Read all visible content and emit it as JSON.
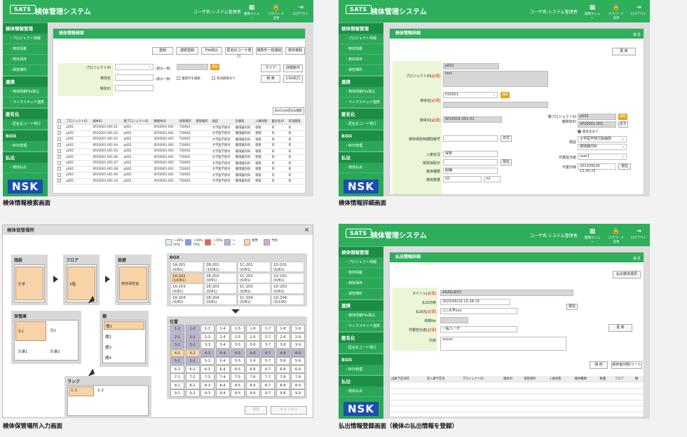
{
  "common": {
    "logo": "SATS",
    "app_title": "検体管理システム",
    "user": "ユーザ名:システム管理者",
    "menu1": "業務メニュー",
    "menu2": "パスワード変更",
    "menu3": "ログアウト",
    "nsk": "NSK",
    "nav": [
      {
        "t": "sec",
        "label": "検体情報管理"
      },
      {
        "t": "sub",
        "label": "・プロジェクト情報"
      },
      {
        "t": "sub",
        "label": "・検体情報"
      },
      {
        "t": "sub",
        "label": "・検体保存"
      },
      {
        "t": "sub",
        "label": "・保管場所"
      },
      {
        "t": "sec",
        "label": "連携"
      },
      {
        "t": "sub",
        "label": "・検体情報File取込"
      },
      {
        "t": "sub",
        "label": "・ラックスキャナ連携"
      },
      {
        "t": "sec",
        "label": "匿名化"
      },
      {
        "t": "sub",
        "label": "・匿名化コード発行"
      },
      {
        "t": "sec",
        "label": "BOX"
      },
      {
        "t": "sub",
        "label": "・BOX管理"
      },
      {
        "t": "sec",
        "label": "払出"
      },
      {
        "t": "sub",
        "label": "・検体払出"
      }
    ]
  },
  "captions": {
    "p1": "検体情報検索画面",
    "p2": "検体情報詳細画面",
    "p3": "検体保管場所入力画面",
    "p4": "払出情報登録画面（検体の払出情報を登録）"
  },
  "search": {
    "title": "検体情報検索",
    "buttons": [
      "登録",
      "連続登録",
      "File取込",
      "匿名化コード発行",
      "複数件一括連結",
      "検体複製"
    ],
    "label_project": "プロジェクトID",
    "label_name": "検体名",
    "label_sampleid": "検体ID",
    "chk_partial": "(部分一致)",
    "chk1": "連続行を検索",
    "chk2": "有効期限あり",
    "btn_go": "選択",
    "btn_clear": "クリア",
    "btn_detail": "詳細条件",
    "btn_search": "検 索",
    "btn_csv": "CSV出力",
    "btn_barcode": "BarCode読込&検索",
    "columns": [
      "",
      "プロジェクトID",
      "検体ID",
      "親プロジェクトID",
      "親検体ID",
      "保管場所",
      "保管場所",
      "組成",
      "診療科",
      "入庫状態",
      "匿名化ID",
      "有効期限"
    ],
    "rows": [
      [
        "",
        "p002",
        "SP20001-001-01",
        "p002",
        "SP20001-001",
        "T20001",
        "",
        "大学医学部付",
        "循環器内科",
        "保管",
        "有",
        "有"
      ],
      [
        "",
        "p002",
        "SP20001-001-02",
        "p002",
        "SP20001-001",
        "T20001",
        "",
        "大学医学部付",
        "循環器内科",
        "保管",
        "有",
        "有"
      ],
      [
        "",
        "p002",
        "SP20001-001-03",
        "p002",
        "SP20001-001",
        "T20001",
        "",
        "大学医学部付",
        "循環器内科",
        "保管",
        "有",
        "有"
      ],
      [
        "",
        "p002",
        "SP20001-001-04",
        "p002",
        "SP20001-001",
        "T20001",
        "",
        "大学医学部付",
        "循環器内科",
        "保管",
        "有",
        "有"
      ],
      [
        "",
        "p002",
        "SP20001-001-05",
        "p002",
        "SP20001-001",
        "T20001",
        "",
        "大学医学部付",
        "循環器内科",
        "保管",
        "有",
        "有"
      ],
      [
        "",
        "p002",
        "SP20001-001-06",
        "p002",
        "SP20001-001",
        "T20001",
        "",
        "大学医学部付",
        "循環器内科",
        "保管",
        "有",
        "有"
      ],
      [
        "",
        "p002",
        "SP20001-001-07",
        "p002",
        "SP20001-001",
        "T20001",
        "",
        "大学医学部付",
        "循環器内科",
        "保管",
        "有",
        "有"
      ],
      [
        "",
        "p002",
        "SP20001-001-08",
        "p002",
        "SP20001-001",
        "T20001",
        "",
        "大学医学部付",
        "循環器内科",
        "保管",
        "有",
        "有"
      ],
      [
        "",
        "p002",
        "SP20001-001-09",
        "p002",
        "SP20001-001",
        "T20001",
        "",
        "大学医学部付",
        "循環器内科",
        "保管",
        "有",
        "有"
      ],
      [
        "",
        "p002",
        "SP20001-001-10",
        "p002",
        "SP20001-001",
        "T20001",
        "",
        "大学医学部付",
        "循環器内科",
        "保管",
        "有",
        "有"
      ]
    ]
  },
  "detail": {
    "title": "検体情報詳細",
    "back": "戻る",
    "btn_update": "更 新",
    "project_label": "プロジェクトID",
    "req": "[必須]",
    "project_val": "p002",
    "project_name": "test",
    "sample_label": "検体名",
    "sample_val": "P20001",
    "select_btn": "選択",
    "sampleid_label": "検体ID",
    "sampleid_val": "SP20001-001-01",
    "parent_label": "親プロジェクトID\n親検体ID",
    "parent_proj": "p002",
    "parent_sample": "SP20001-001",
    "clear_btn": "選択",
    "release_btn": "戻す",
    "fields_left": [
      {
        "label": "検体保管時期間番号",
        "val": ""
      },
      {
        "label": "入庫状況",
        "val": "保管"
      },
      {
        "label": "検体採取日",
        "val": ""
      },
      {
        "label": "検体種類",
        "val": "組織"
      },
      {
        "label": "検体数量",
        "val": "10"
      }
    ],
    "unit": "ml",
    "calendar": "日付",
    "chk_anon": "匿名化あり",
    "facility_label": "施設",
    "facility_val": "大学医学部付属病院",
    "dept_val": "循環器内科",
    "creator_label": "作業担当者",
    "creator_val": "user1",
    "created_label": "作業日時",
    "created_val": "2023/06/30 13:30:23",
    "now_btn": "現在"
  },
  "storage": {
    "title": "検体保管場所",
    "close": "×",
    "legend": [
      {
        "label": "〜30%\n50%",
        "color": "#d6f3fb"
      },
      {
        "label": "〜50%\n70%",
        "color": "#6aa3f2"
      },
      {
        "label": "〜70%\n〜",
        "color": "#f25c4a"
      },
      {
        "label": "〜\n〜",
        "color": "#b9b4cf"
      },
      {
        "label": "使用",
        "color": "#f9d3a8"
      },
      {
        "label": "予約",
        "color": "#d8a8d8"
      }
    ],
    "facility": "施設",
    "facility_item": "大学",
    "floor": "フロア",
    "floor_item": "3階",
    "room": "部屋",
    "room_item": "検体保管室",
    "storage": "保管庫",
    "storage_items": [
      "冷1",
      "冷2",
      "冷凍1",
      "冷凍2"
    ],
    "shelf": "棚",
    "shelf_items": [
      "棚1",
      "棚2",
      "棚3",
      "棚4"
    ],
    "rack": "ラック",
    "rack_items": [
      "1-1",
      "1-2"
    ],
    "box_title": "BOX",
    "box_cells": [
      "1A-201\n(0/81)",
      "1B-201\n(10/81)",
      "1C-201\n(0/81)",
      "1D-201\n(0/81)",
      "1A-202\n(18/81)",
      "1B-202\n(0/81)",
      "1C-202\n(0/81)",
      "1D-202\n(0/81)",
      "1A-203\n(0/81)",
      "1B-203\n(0/81)",
      "1C-203\n(0/81)",
      "1D-203\n(0/81)",
      "1A-204\n(0/81)",
      "1B-204\n(0/81)",
      "1C-204\n(0/81)",
      "1D-204\n(0/100)"
    ],
    "pos_title": "位置",
    "ok": "決定",
    "cancel": "キャンセル"
  },
  "payout": {
    "title": "払出情報詳細",
    "back": "戻る",
    "btn_select": "払出検体選択",
    "fields": [
      {
        "label": "タイトル",
        "req": "[必須]",
        "val": "AAA払出03"
      },
      {
        "label": "払出日時",
        "req": "",
        "val": "2023/06/19 15:38:19"
      },
      {
        "label": "払出先",
        "req": "[必須]",
        "val": "○○大学xxx"
      },
      {
        "label": "依頼No",
        "req": "",
        "val": ""
      },
      {
        "label": "作業担当者",
        "req": "[必須]",
        "val": "一般ユーザ"
      },
      {
        "label": "内容",
        "req": "",
        "val": "xxxxx"
      }
    ],
    "now_btn": "現在",
    "update": "更 新",
    "btn_ok": "保 存",
    "btn_report": "保存後印刷/リート",
    "columns": [
      "出庫予定日時",
      "前入庫予定日",
      "プロジェクトID",
      "検体ID",
      "保管場所",
      "入庫状態",
      "検体種類",
      "数量",
      "フロア",
      "棚"
    ]
  }
}
